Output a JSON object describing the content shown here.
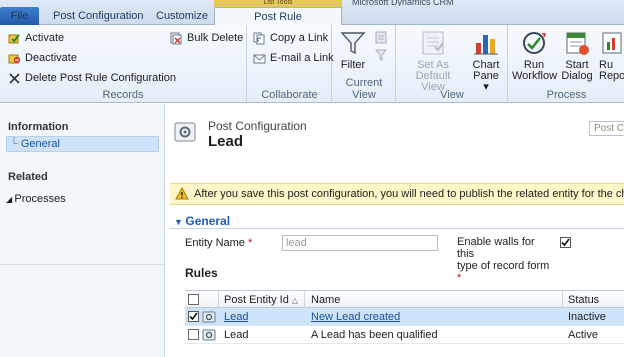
{
  "tabs": {
    "file": "File",
    "post_configuration": "Post Configuration",
    "customize": "Customize",
    "post_rule_configurations": "Post Rule Configurations",
    "contextual_group": "List Tools",
    "app_title": "Microsoft Dynamics CRM"
  },
  "ribbon": {
    "records": {
      "label": "Records",
      "activate": "Activate",
      "deactivate": "Deactivate",
      "delete": "Delete Post Rule Configuration",
      "bulk_delete": "Bulk Delete"
    },
    "collaborate": {
      "label": "Collaborate",
      "copy_link": "Copy a Link",
      "email_link": "E-mail a Link"
    },
    "current_view": {
      "label": "Current View",
      "filter": "Filter"
    },
    "view": {
      "label": "View",
      "set_default_line1": "Set As Default",
      "set_default_line2": "View",
      "chart_pane_line1": "Chart",
      "chart_pane_line2": "Pane ▾"
    },
    "process": {
      "label": "Process",
      "run_workflow_line1": "Run",
      "run_workflow_line2": "Workflow",
      "start_dialog_line1": "Start",
      "start_dialog_line2": "Dialog",
      "run_report_line1": "Ru",
      "run_report_line2": "Repo"
    }
  },
  "nav": {
    "information": "Information",
    "general": "General",
    "related": "Related",
    "processes": "Processes"
  },
  "form": {
    "entity_label": "Post Configuration",
    "record_name": "Lead",
    "search_placeholder": "Post Co",
    "notice": "After you save this post configuration, you will need to publish the related entity for the changes t",
    "section_title": "General",
    "entity_name_label": "Entity Name",
    "entity_name_value": "lead",
    "walls_label_line1": "Enable walls for this",
    "walls_label_line2": "type of record form",
    "walls_checked": true,
    "rules_label": "Rules"
  },
  "grid": {
    "columns": [
      "Post Entity Id",
      "Name",
      "Status"
    ],
    "sort_indicator": "△",
    "rows": [
      {
        "entity": "Lead",
        "name": "New Lead created",
        "status": "Inactive",
        "selected": true
      },
      {
        "entity": "Lead",
        "name": "A Lead has been qualified",
        "status": "Active",
        "selected": false
      }
    ]
  },
  "colors": {
    "accent": "#1e60b5",
    "file_tab": "#2a66b5",
    "notice_bg": "#fff7c7",
    "selected_row": "#cde3fb"
  }
}
